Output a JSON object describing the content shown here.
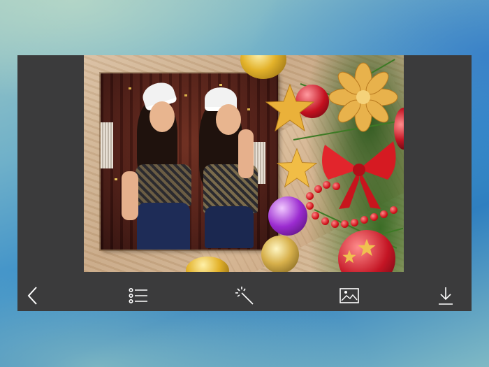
{
  "app": {
    "accent": "#3b3b3c",
    "background_gradient": [
      "#9fc9c4",
      "#3b8fc9",
      "#7fb9c4"
    ]
  },
  "canvas": {
    "frame_theme": "christmas-wood-frame",
    "photo_subject": "two-women-in-santa-hats"
  },
  "toolbar": {
    "items": [
      {
        "name": "back",
        "icon": "chevron-left-icon"
      },
      {
        "name": "frames-list",
        "icon": "list-icon"
      },
      {
        "name": "effects",
        "icon": "magic-wand-icon"
      },
      {
        "name": "gallery",
        "icon": "image-icon"
      },
      {
        "name": "download",
        "icon": "download-icon"
      }
    ]
  }
}
